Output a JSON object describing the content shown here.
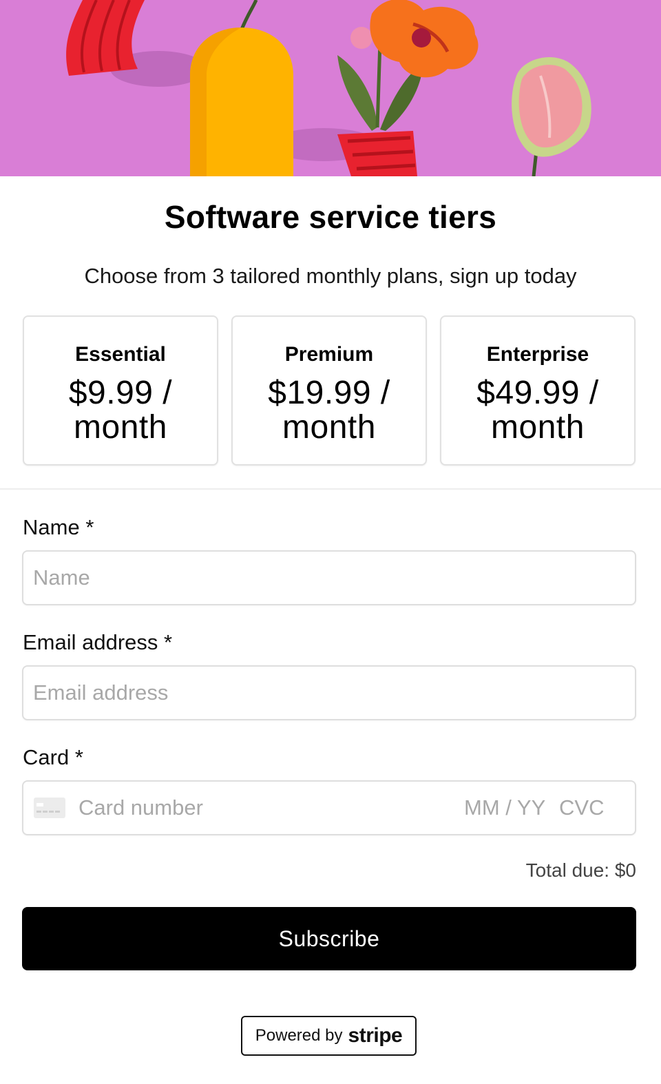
{
  "header": {
    "title": "Software service tiers",
    "subtitle": "Choose from 3 tailored monthly plans, sign up today"
  },
  "tiers": [
    {
      "name": "Essential",
      "price": "$9.99 / month"
    },
    {
      "name": "Premium",
      "price": "$19.99 / month"
    },
    {
      "name": "Enterprise",
      "price": "$49.99 / month"
    }
  ],
  "form": {
    "name": {
      "label": "Name",
      "required_mark": "*",
      "placeholder": "Name"
    },
    "email": {
      "label": "Email address",
      "required_mark": "*",
      "placeholder": "Email address"
    },
    "card": {
      "label": "Card",
      "required_mark": "*",
      "number_placeholder": "Card number",
      "expiry_placeholder": "MM / YY",
      "cvc_placeholder": "CVC",
      "icon": "credit-card-icon"
    }
  },
  "summary": {
    "total_due": "Total due: $0"
  },
  "actions": {
    "subscribe_label": "Subscribe"
  },
  "footer": {
    "powered_by": "Powered by",
    "brand": "stripe"
  },
  "colors": {
    "hero_background": "#d97ed6",
    "button_background": "#000000",
    "button_text": "#ffffff"
  }
}
